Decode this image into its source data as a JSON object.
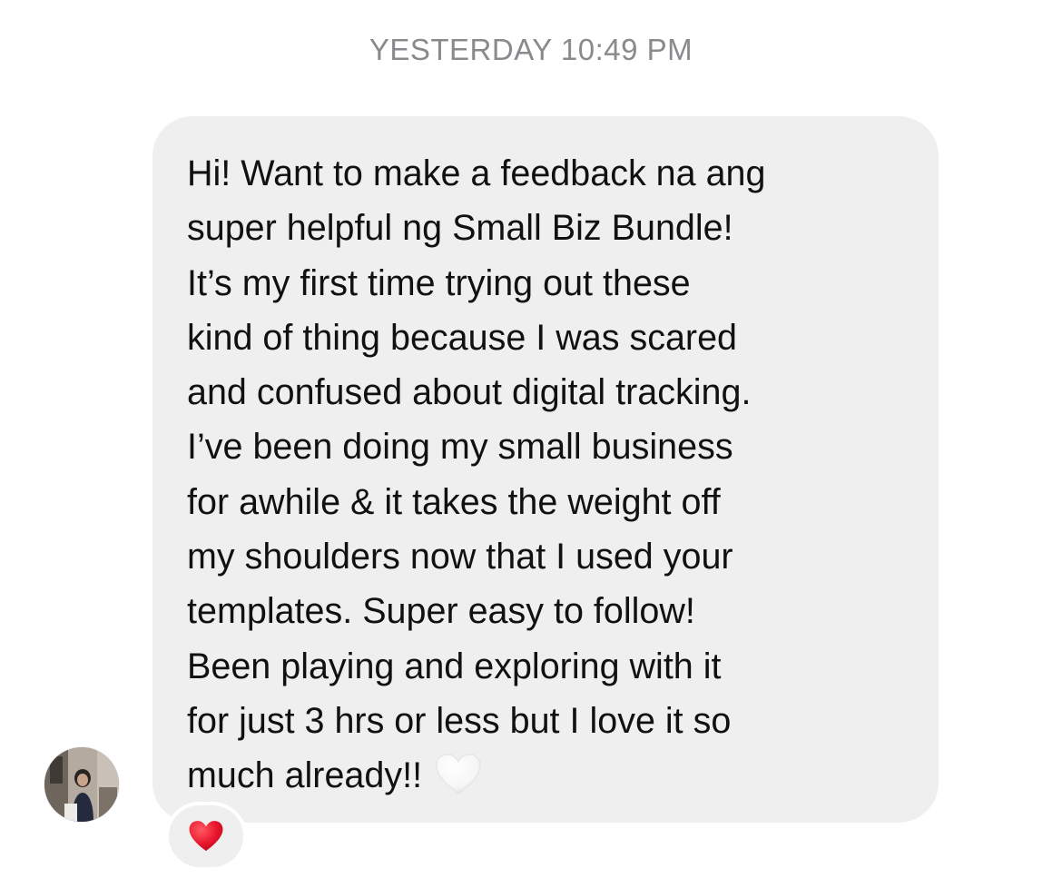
{
  "timestamp": "YESTERDAY 10:49 PM",
  "message": {
    "lines": [
      "Hi! Want to make a feedback na ang",
      "super helpful ng Small Biz Bundle!",
      "It’s my first time trying out these",
      "kind of thing because I was scared",
      "and confused about digital tracking.",
      "I’ve been doing my small business",
      "for awhile & it takes the weight off",
      "my shoulders now that I used your",
      "templates. Super easy to follow!",
      "Been playing and exploring with it",
      "for just 3 hrs or less but I love it so",
      "much already!!"
    ],
    "inline_emoji": "white-heart-icon"
  },
  "reaction": {
    "icon": "red-heart-icon",
    "color": "#e8152c"
  },
  "colors": {
    "bubble_bg": "#efeff0",
    "timestamp_text": "#8a8a8e",
    "message_text": "#111111"
  }
}
